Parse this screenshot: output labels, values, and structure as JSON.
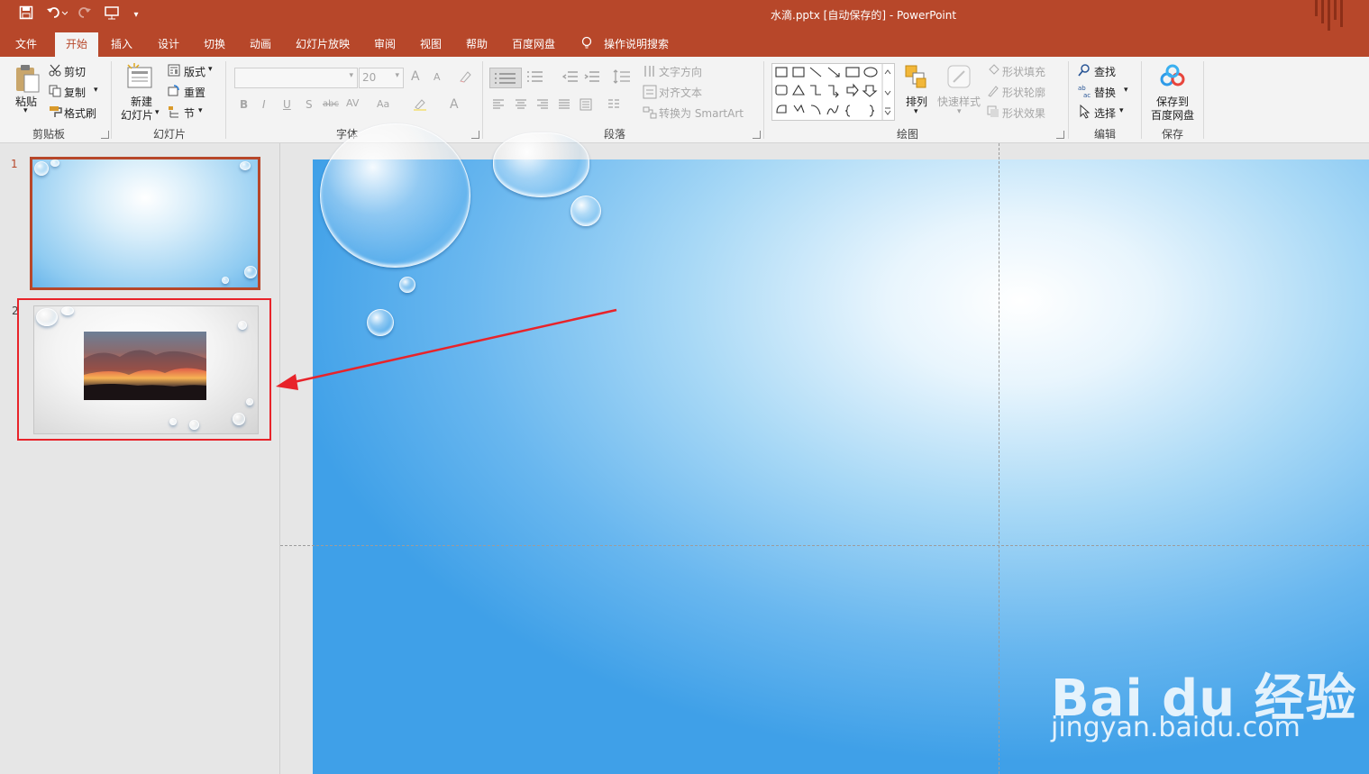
{
  "window": {
    "title": "水滴.pptx [自动保存的]  -  PowerPoint"
  },
  "quick_access": {
    "save_icon": "save-icon",
    "undo_icon": "undo-icon",
    "redo_icon": "redo-icon",
    "from_beginning_icon": "presentation-icon",
    "customize_icon": "customize-toolbar-icon"
  },
  "tabs": [
    "文件",
    "开始",
    "插入",
    "设计",
    "切换",
    "动画",
    "幻灯片放映",
    "审阅",
    "视图",
    "帮助",
    "百度网盘"
  ],
  "tell_me": "操作说明搜索",
  "ribbon": {
    "clipboard": {
      "label": "剪贴板",
      "paste": "粘贴",
      "cut": "剪切",
      "copy": "复制",
      "format_painter": "格式刷"
    },
    "slides": {
      "label": "幻灯片",
      "new_slide_line1": "新建",
      "new_slide_line2": "幻灯片",
      "layout": "版式",
      "reset": "重置",
      "section": "节"
    },
    "font": {
      "label": "字体",
      "font_name": "",
      "font_size": "20",
      "bold": "B",
      "italic": "I",
      "underline": "U",
      "shadow": "S",
      "strike": "abc",
      "spacing": "AV",
      "case": "Aa",
      "color": "A",
      "grow": "A",
      "shrink": "A"
    },
    "paragraph": {
      "label": "段落",
      "text_direction": "文字方向",
      "align_text": "对齐文本",
      "convert_smartart": "转换为 SmartArt"
    },
    "drawing": {
      "label": "绘图",
      "arrange": "排列",
      "quick_styles": "快速样式",
      "shape_fill": "形状填充",
      "shape_outline": "形状轮廓",
      "shape_effects": "形状效果"
    },
    "editing": {
      "label": "编辑",
      "find": "查找",
      "replace": "替换",
      "select": "选择"
    },
    "save": {
      "label": "保存",
      "save_to_line1": "保存到",
      "save_to_line2": "百度网盘"
    }
  },
  "thumbnails": [
    {
      "number": "1"
    },
    {
      "number": "2"
    }
  ],
  "watermark": {
    "brand": "Bai du 经验",
    "url": "jingyan.baidu.com"
  },
  "colors": {
    "accent": "#b7472a",
    "highlight": "#e8232a",
    "slide_blue": "#3fa0e8"
  }
}
